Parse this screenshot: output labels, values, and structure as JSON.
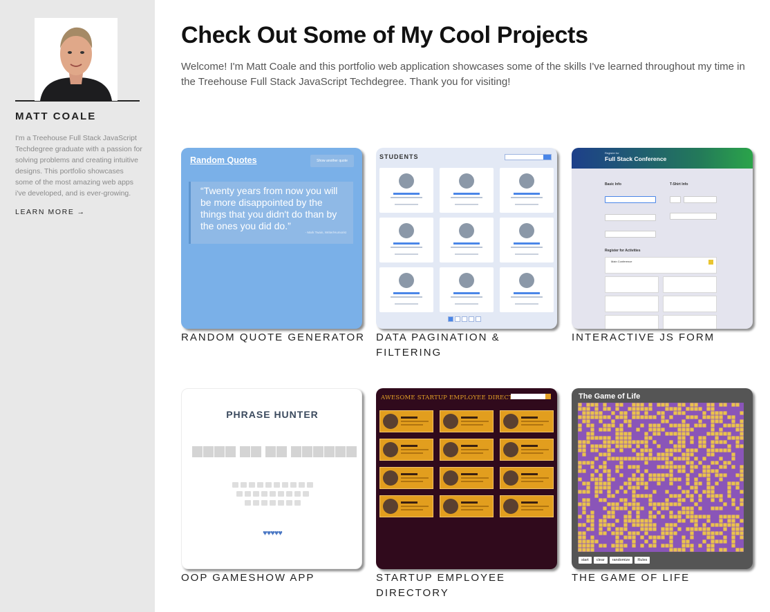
{
  "sidebar": {
    "name": "MATT COALE",
    "bio": "I'm a Treehouse Full Stack JavaScript Techdegree graduate with a passion for solving problems and creating intuitive designs. This portfolio showcases some of the most amazing web apps i've developed, and is ever-growing.",
    "learn_more": "LEARN MORE",
    "learn_more_arrow": "→"
  },
  "main": {
    "title": "Check Out Some of My Cool Projects",
    "intro": "Welcome! I'm Matt Coale and this portfolio web application showcases some of the skills I've learned throughout my time in the Treehouse Full Stack JavaScript Techdegree. Thank you for visiting!"
  },
  "projects": [
    {
      "label": "RANDOM QUOTE GENERATOR",
      "thumb": {
        "title": "Random Quotes",
        "button": "Show another quote",
        "quote": "Twenty years from now you will be more disappointed by the things that you didn't do than by the ones you did do.",
        "author": "- Mark Twain, Writer/Humorist"
      }
    },
    {
      "label": "DATA PAGINATION & FILTERING",
      "thumb": {
        "title": "STUDENTS"
      }
    },
    {
      "label": "INTERACTIVE JS FORM",
      "thumb": {
        "register": "Register for",
        "title": "Full Stack Conference",
        "basic_info": "Basic Info",
        "tshirt_info": "T-Shirt Info",
        "activities": "Register for Activities",
        "main_conference": "Main Conference"
      }
    },
    {
      "label": "OOP GAMESHOW APP",
      "thumb": {
        "title": "PHRASE HUNTER",
        "hearts": "♥♥♥♥♥"
      }
    },
    {
      "label": "STARTUP EMPLOYEE DIRECTORY",
      "thumb": {
        "title": "AWESOME STARTUP EMPLOYEE DIRECTORY"
      }
    },
    {
      "label": "THE GAME OF LIFE",
      "thumb": {
        "title": "The Game of Life",
        "buttons": [
          "start",
          "clear",
          "randomize",
          "Rules"
        ]
      }
    }
  ],
  "colors": {
    "sidebar_bg": "#e8e8e8",
    "quote_blue": "#7ab0e8",
    "students_bg": "#e3e9f5",
    "form_bg": "#e4e4ee",
    "directory_bg": "#300a1c",
    "directory_accent": "#e29e1e",
    "life_purple": "#8a55b8",
    "life_yellow": "#eac24d"
  }
}
